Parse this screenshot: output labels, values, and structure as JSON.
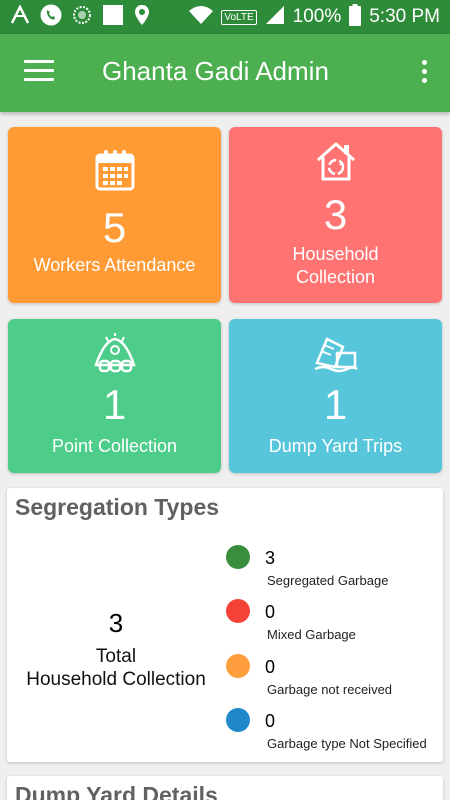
{
  "status_bar": {
    "battery": "100%",
    "time": "5:30 PM",
    "network": "VoLTE",
    "icons": [
      "app-a-icon",
      "phone-icon",
      "loader-icon",
      "square-icon",
      "location-icon",
      "wifi-icon",
      "volte-icon",
      "signal-icon",
      "battery-icon"
    ]
  },
  "appbar": {
    "title": "Ghanta Gadi Admin",
    "menu_icon": "hamburger-menu-icon",
    "more_icon": "more-vertical-icon"
  },
  "cards": [
    {
      "value": "5",
      "label": "Workers Attendance",
      "icon": "calendar-icon",
      "color": "#ff9a34"
    },
    {
      "value": "3",
      "label": "Household Collection",
      "icon": "house-recycle-icon",
      "color": "#ff7373"
    },
    {
      "value": "1",
      "label": "Point Collection",
      "icon": "garbage-pile-icon",
      "color": "#4dcc8a"
    },
    {
      "value": "1",
      "label": "Dump Yard Trips",
      "icon": "dump-truck-icon",
      "color": "#58c6da"
    }
  ],
  "segregation": {
    "title": "Segregation Types",
    "total_value": "3",
    "total_label_line1": "Total",
    "total_label_line2": "Household Collection",
    "legend": [
      {
        "value": "3",
        "label": "Segregated Garbage",
        "color": "#388e3c"
      },
      {
        "value": "0",
        "label": "Mixed Garbage",
        "color": "#f44336"
      },
      {
        "value": "0",
        "label": "Garbage not received",
        "color": "#ff9e3d"
      },
      {
        "value": "0",
        "label": "Garbage type Not Specified",
        "color": "#1e88c8"
      }
    ]
  },
  "dump_yard": {
    "title": "Dump Yard Details"
  }
}
